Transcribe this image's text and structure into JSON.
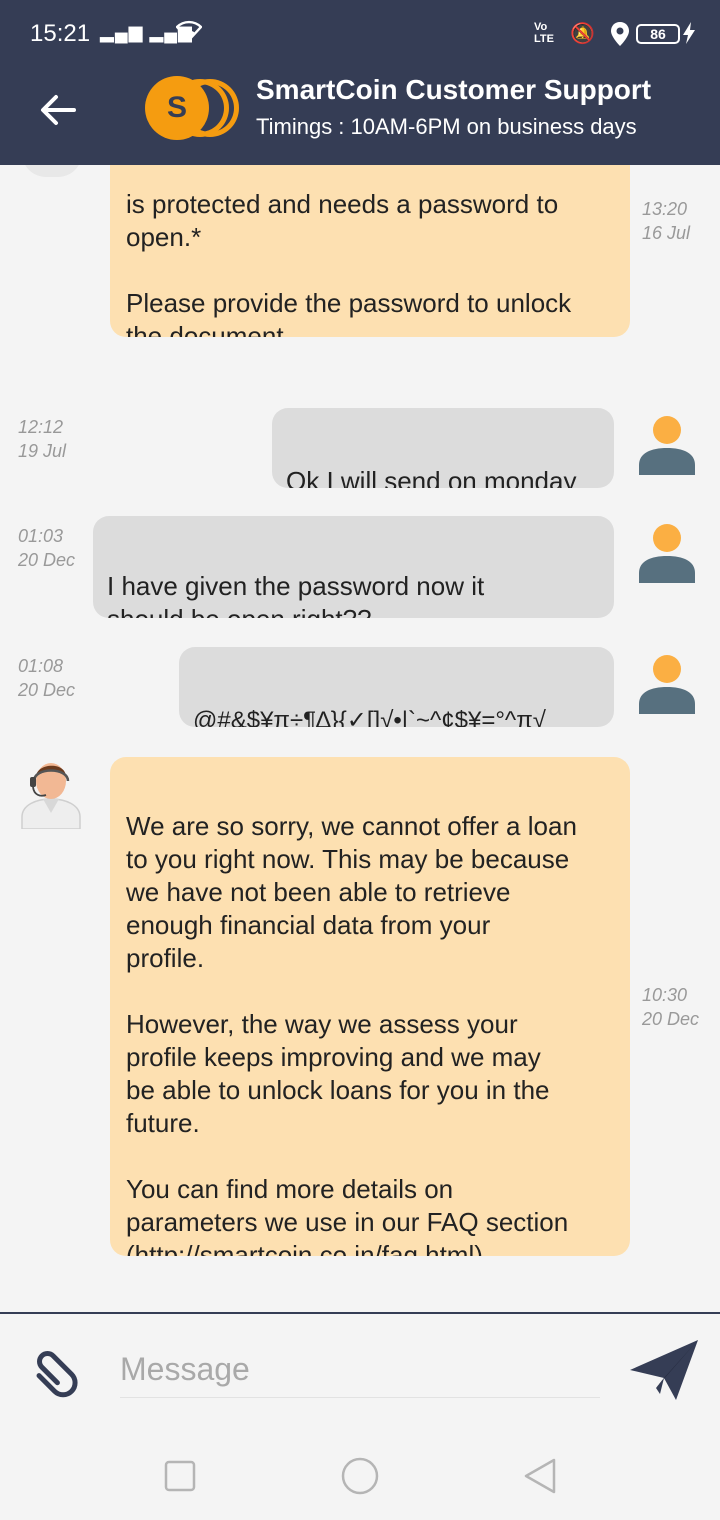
{
  "status_bar": {
    "time": "15:21",
    "signal": "▂▄▆ ▂▄▆",
    "wifi_icon": "wifi-icon",
    "volte": "Vo\nLTE",
    "battery": "86"
  },
  "header": {
    "logo_letter": "S",
    "title": "SmartCoin Customer Support",
    "subtitle": "Timings : 10AM-6PM on business days"
  },
  "messages": [
    {
      "sender": "agent",
      "text": "is protected and needs a password to\nopen.*\n\nPlease provide the password to unlock\nthe document.",
      "time": "13:20\n16 Jul"
    },
    {
      "sender": "user",
      "text": "Ok I will send on monday",
      "time": "12:12\n19 Jul"
    },
    {
      "sender": "user",
      "text": "I have given the password now it\nshould be open right??",
      "time": "01:03\n20 Dec"
    },
    {
      "sender": "user",
      "text": "@#&$¥π÷¶∆}{✓[]√•|`~^¢$¥=°^π√",
      "time": "01:08\n20 Dec"
    },
    {
      "sender": "agent",
      "text": "We are so sorry, we cannot offer a loan\nto you right now. This may be because\nwe have not been able to retrieve\nenough financial data from your\nprofile.\n\nHowever, the way we assess your\nprofile keeps improving and we may\nbe able to unlock loans for you in the\nfuture.\n\nYou can find more details on\nparameters we use in our FAQ section\n",
      "link": "(http://smartcoin.co.in/faq.html).",
      "time": "10:30\n20 Dec"
    }
  ],
  "composer": {
    "placeholder": "Message"
  },
  "colors": {
    "header_bg": "#353d55",
    "agent_bubble": "#fde0b1",
    "user_bubble": "#dcdcdc",
    "accent": "#f59c10"
  }
}
